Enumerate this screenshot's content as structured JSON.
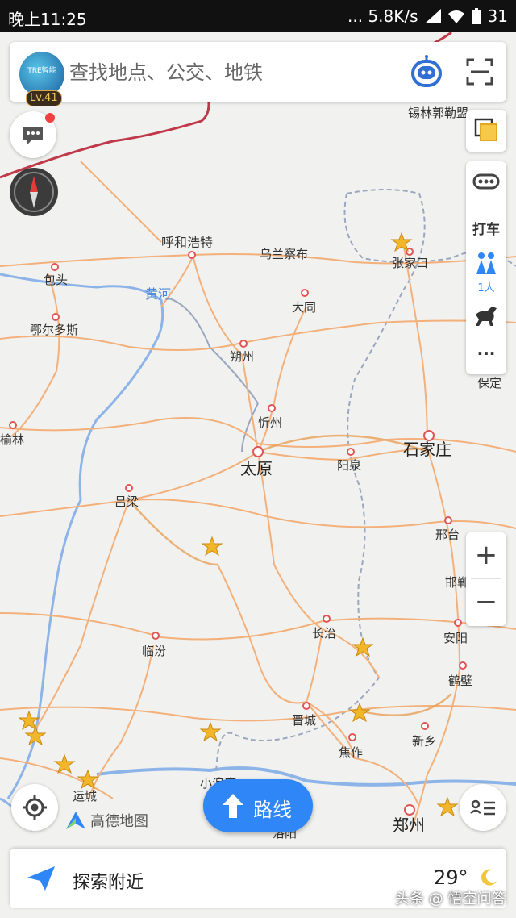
{
  "statusbar": {
    "time": "晚上11:25",
    "speed": "... 5.8K/s",
    "battery": "31"
  },
  "search": {
    "placeholder": "查找地点、公交、地铁",
    "level": "Lv.41",
    "avatar_text": "TRE智能"
  },
  "side_panel": {
    "taxi_label": "打车",
    "people_label": "1人",
    "more_label": "···"
  },
  "zoom": {
    "in": "+",
    "out": "−"
  },
  "route_button": {
    "label": "路线"
  },
  "logo": {
    "text": "高德地图"
  },
  "bottom": {
    "explore_label": "探索附近",
    "temperature": "29°"
  },
  "watermark": {
    "text": "头条 @ 悟空问答"
  },
  "map": {
    "river_label": "黄河",
    "cities": [
      {
        "name": "呼和浩特",
        "size": "normal"
      },
      {
        "name": "乌兰察布",
        "size": "small"
      },
      {
        "name": "包头",
        "size": "small"
      },
      {
        "name": "鄂尔多斯",
        "size": "small"
      },
      {
        "name": "大同",
        "size": "small"
      },
      {
        "name": "朔州",
        "size": "small"
      },
      {
        "name": "张家口",
        "size": "small"
      },
      {
        "name": "锡林郭勒盟",
        "size": "small"
      },
      {
        "name": "忻州",
        "size": "small"
      },
      {
        "name": "榆林",
        "size": "small"
      },
      {
        "name": "太原",
        "size": "big"
      },
      {
        "name": "阳泉",
        "size": "small"
      },
      {
        "name": "石家庄",
        "size": "big"
      },
      {
        "name": "保定",
        "size": "small"
      },
      {
        "name": "吕梁",
        "size": "small"
      },
      {
        "name": "邢台",
        "size": "small"
      },
      {
        "name": "邯郸",
        "size": "small"
      },
      {
        "name": "长治",
        "size": "small"
      },
      {
        "name": "安阳",
        "size": "small"
      },
      {
        "name": "临汾",
        "size": "small"
      },
      {
        "name": "鹤壁",
        "size": "small"
      },
      {
        "name": "晋城",
        "size": "small"
      },
      {
        "name": "焦作",
        "size": "small"
      },
      {
        "name": "新乡",
        "size": "small"
      },
      {
        "name": "运城",
        "size": "small"
      },
      {
        "name": "郑州",
        "size": "big"
      },
      {
        "name": "洛阳",
        "size": "small"
      },
      {
        "name": "小浪底",
        "size": "small"
      }
    ]
  }
}
